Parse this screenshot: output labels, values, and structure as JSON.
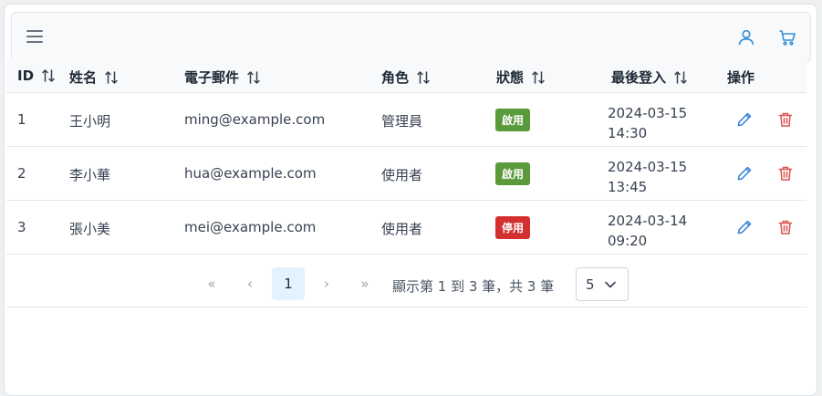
{
  "toolbar": {
    "menu_icon": "hamburger-icon",
    "user_icon": "user-icon",
    "cart_icon": "cart-icon"
  },
  "table": {
    "headers": {
      "id": "ID",
      "name": "姓名",
      "email": "電子郵件",
      "role": "角色",
      "status": "狀態",
      "last_login": "最後登入",
      "actions": "操作"
    },
    "rows": [
      {
        "id": "1",
        "name": "王小明",
        "email": "ming@example.com",
        "role": "管理員",
        "status": "啟用",
        "status_active": true,
        "login_date": "2024-03-15",
        "login_time": "14:30"
      },
      {
        "id": "2",
        "name": "李小華",
        "email": "hua@example.com",
        "role": "使用者",
        "status": "啟用",
        "status_active": true,
        "login_date": "2024-03-15",
        "login_time": "13:45"
      },
      {
        "id": "3",
        "name": "張小美",
        "email": "mei@example.com",
        "role": "使用者",
        "status": "停用",
        "status_active": false,
        "login_date": "2024-03-14",
        "login_time": "09:20"
      }
    ],
    "colors": {
      "active": "#5a9a3a",
      "inactive": "#d32f2f",
      "edit": "#2f7fd6",
      "delete": "#d9534f",
      "accent": "#2f8fd6"
    }
  },
  "pagination": {
    "first": "«",
    "prev": "‹",
    "current_page": "1",
    "next": "›",
    "last": "»",
    "info": "顯示第 1 到 3 筆，共 3 筆",
    "page_size": "5"
  }
}
